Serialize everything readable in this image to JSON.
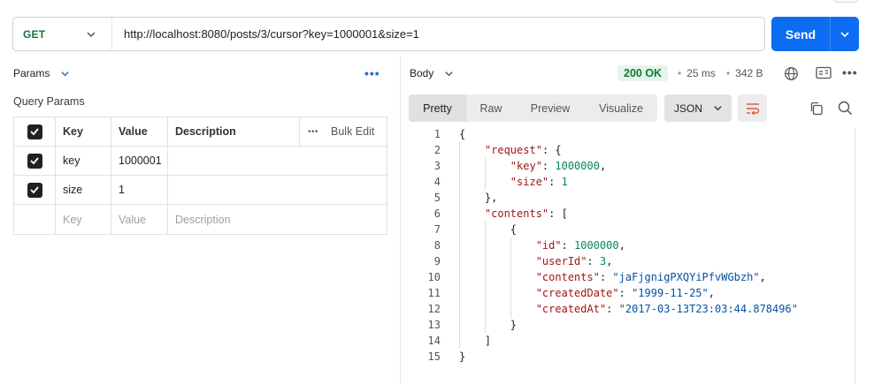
{
  "request": {
    "method": "GET",
    "url": "http://localhost:8080/posts/3/cursor?key=1000001&size=1",
    "send_label": "Send"
  },
  "left_panel": {
    "tab_label": "Params",
    "section_title": "Query Params",
    "table": {
      "headers": [
        "Key",
        "Value",
        "Description"
      ],
      "bulk_edit_label": "Bulk Edit",
      "rows": [
        {
          "key": "key",
          "value": "1000001",
          "description": "",
          "checked": true
        },
        {
          "key": "size",
          "value": "1",
          "description": "",
          "checked": true
        }
      ],
      "placeholder": {
        "key": "Key",
        "value": "Value",
        "description": "Description"
      }
    }
  },
  "response": {
    "tab_label": "Body",
    "status": "200 OK",
    "time": "25 ms",
    "size": "342 B",
    "view_tabs": [
      "Pretty",
      "Raw",
      "Preview",
      "Visualize"
    ],
    "active_view": "Pretty",
    "format": "JSON",
    "code_lines": [
      "1",
      "2",
      "3",
      "4",
      "5",
      "6",
      "7",
      "8",
      "9",
      "10",
      "11",
      "12",
      "13",
      "14",
      "15"
    ]
  },
  "colors": {
    "send": "#0d6df2",
    "method": "#0b7a3b",
    "status_bg": "#e6f4ea",
    "json_key": "#a31515",
    "json_number": "#098658",
    "json_string": "#0451a5",
    "wrap_icon": "#e2533c"
  },
  "icons": [
    "chevron-down-icon",
    "more-icon",
    "globe-icon",
    "save-response-icon",
    "wrap-lines-icon",
    "copy-icon",
    "search-icon",
    "check-icon"
  ]
}
